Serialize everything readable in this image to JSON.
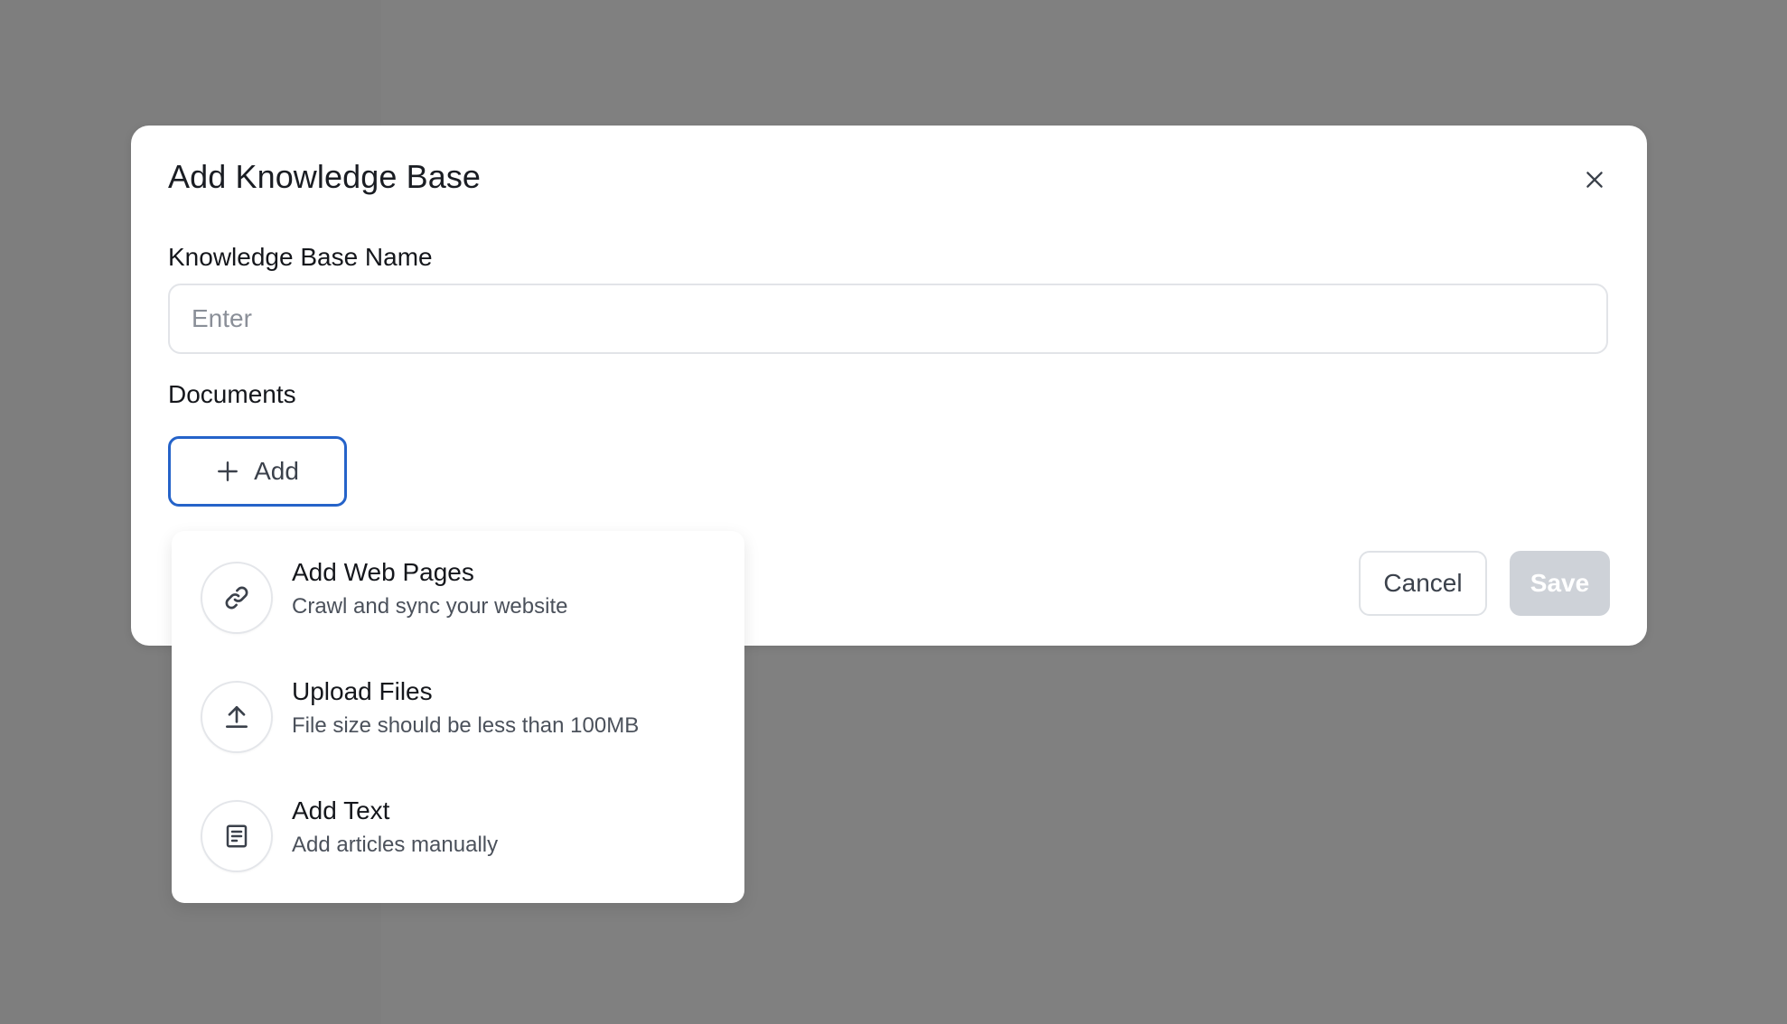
{
  "dialog": {
    "title": "Add Knowledge Base",
    "close_icon": "close-icon"
  },
  "form": {
    "name_label": "Knowledge Base Name",
    "name_placeholder": "Enter",
    "name_value": "",
    "documents_label": "Documents",
    "add_button_label": "Add",
    "add_icon": "plus-icon"
  },
  "add_menu": {
    "items": [
      {
        "title": "Add Web Pages",
        "description": "Crawl and sync your website",
        "icon": "link-icon"
      },
      {
        "title": "Upload Files",
        "description": "File size should be less than 100MB",
        "icon": "upload-icon"
      },
      {
        "title": "Add Text",
        "description": "Add articles manually",
        "icon": "document-text-icon"
      }
    ]
  },
  "footer": {
    "cancel_label": "Cancel",
    "save_label": "Save"
  },
  "colors": {
    "overlay": "#808080",
    "accent": "#2563c9",
    "disabled_button": "#ced2d8"
  }
}
